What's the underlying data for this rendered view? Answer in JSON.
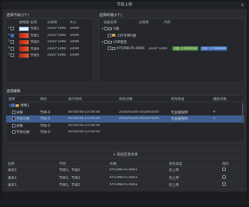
{
  "window": {
    "title": "节目上传",
    "close_glyph": "✕"
  },
  "programs": {
    "section_label": "选择节目(1个)",
    "headers": [
      "缩略图·名称",
      "分辨率",
      "大小"
    ],
    "rows": [
      {
        "num": "1",
        "checked": false,
        "thumb": "t0",
        "name": "节目1",
        "resolution": "1920*1080",
        "size": "100M"
      },
      {
        "num": "2",
        "checked": true,
        "thumb": "t1",
        "name": "节目1",
        "resolution": "1920*1080",
        "size": "100M"
      },
      {
        "num": "3",
        "checked": false,
        "thumb": "t1",
        "name": "节目3",
        "resolution": "1920*1080",
        "size": "100M"
      },
      {
        "num": "4",
        "checked": false,
        "thumb": "t1",
        "name": "节目4",
        "resolution": "1920*1080",
        "size": "100M"
      },
      {
        "num": "5",
        "checked": false,
        "thumb": "t1",
        "name": "节目5",
        "resolution": "1920*1080",
        "size": "100M"
      }
    ]
  },
  "terminals": {
    "section_label": "选择终端(1个)",
    "headers": [
      "设备名称",
      "分辨率",
      "内存"
    ],
    "items": [
      {
        "indent": 0,
        "toggle": "▾",
        "icon": "disk",
        "label": "U盘",
        "resolution": "",
        "memory": ""
      },
      {
        "indent": 1,
        "toggle": "",
        "icon": "folder",
        "label": "工作专用U盘",
        "resolution": "",
        "memory": ""
      },
      {
        "indent": 0,
        "toggle": "▾",
        "icon": "disk",
        "label": "USB直连",
        "resolution": "",
        "memory": ""
      },
      {
        "indent": 1,
        "toggle": "",
        "icon": "monitor",
        "label": "KYSTAR-P1-0004",
        "resolution": "1920*1080",
        "memory_a": "U盘: 4.5GB/8GB",
        "memory_b": "内存: 4.5GB/8GB"
      }
    ]
  },
  "strategy": {
    "section_label": "选择策略",
    "headers": [
      "顺序",
      "目标",
      "执行时间",
      "有效日期",
      "有效性能",
      "播放次数"
    ],
    "rows": [
      {
        "order": "",
        "toggle": "▾",
        "target": "策略1",
        "time": "",
        "date": "",
        "perf": "",
        "count": "",
        "checked": true,
        "is_group": true,
        "selected": false
      },
      {
        "order": "关联",
        "toggle": "",
        "target": "节目-0",
        "time": "00:00:00-23:59:59",
        "date": "2020/01/05-2020/03/05",
        "perf": "无盖播限制",
        "count": "4",
        "checked": false,
        "is_group": false,
        "selected": false
      },
      {
        "order": "节目切换",
        "toggle": "",
        "target": "节目-0",
        "time": "00:00:00-23:59:59",
        "date": "2020/01/05-2020/03/05",
        "perf": "无盖播限制",
        "count": "5",
        "checked": false,
        "is_group": false,
        "selected": true
      },
      {
        "order": "关联",
        "toggle": "",
        "target": "节目-0",
        "time": "00:00:00-23:59:59",
        "date": "",
        "perf": "",
        "count": "",
        "checked": false,
        "is_group": false,
        "selected": false
      },
      {
        "order": "节目切换",
        "toggle": "",
        "target": "节目-0",
        "time": "00:00:00-23:59:59",
        "date": "",
        "perf": "",
        "count": "",
        "checked": false,
        "is_group": false,
        "selected": false
      }
    ]
  },
  "add_list": {
    "label": "+ 添加至发布单"
  },
  "publish": {
    "headers": [
      "名称",
      "节目",
      "终端",
      "发布类型",
      "操作"
    ],
    "rows": [
      {
        "name": "发布1",
        "programs": "节目1，节目2",
        "terminal": "KYSTAR-P1-0002",
        "type": "仅上传"
      },
      {
        "name": "发布1",
        "programs": "节目1，节目2",
        "terminal": "KYSTAR-P1-0002",
        "type": "仅上传"
      },
      {
        "name": "发布1",
        "programs": "节目1，节目2",
        "terminal": "KYSTAR-P1-0002",
        "type": "仅上传"
      }
    ]
  },
  "colors": {
    "accent": "#3b6fc1",
    "selected_row": "#3f5f93",
    "thumb_red": "#c8321f"
  }
}
